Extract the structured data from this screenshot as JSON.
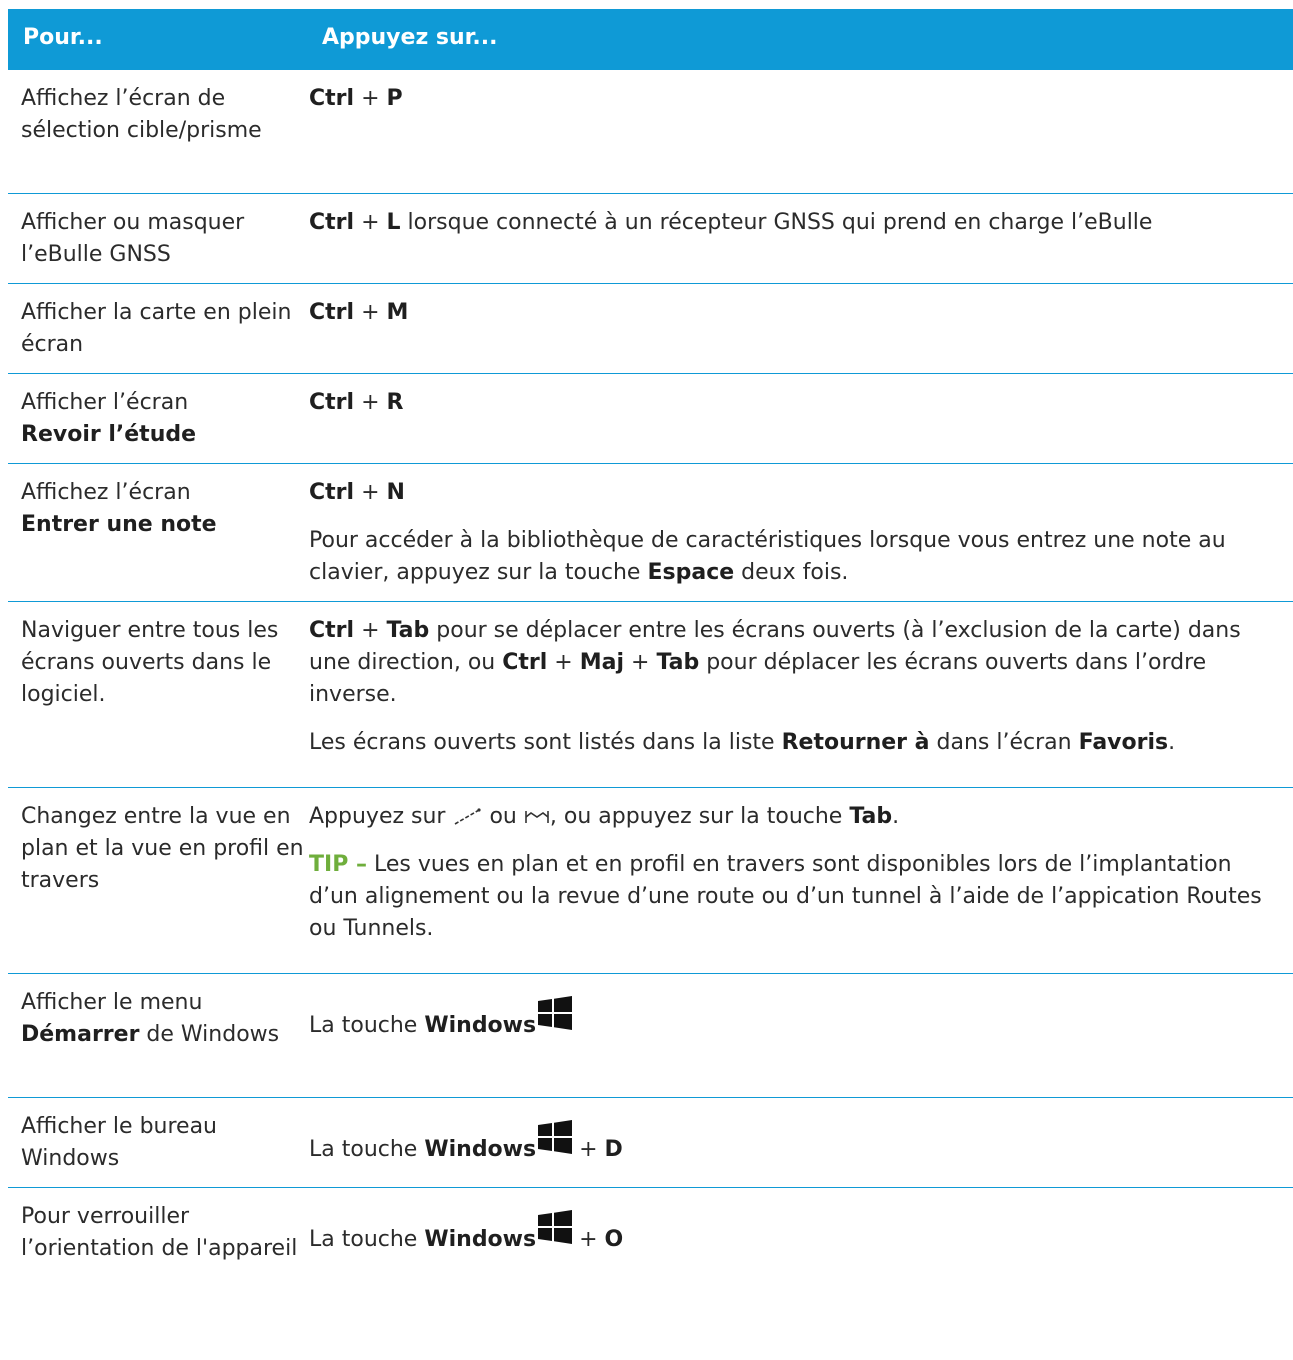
{
  "header": {
    "col1": "Pour...",
    "col2": "Appuyez sur..."
  },
  "rows": {
    "r0": {
      "left": "Affichez l’écran de sélection cible/prisme",
      "ctrl": "Ctrl",
      "plus": "+",
      "key": "P"
    },
    "r1": {
      "left": "Afficher ou masquer l’eBulle GNSS",
      "ctrl": "Ctrl",
      "plus": "+",
      "key": "L",
      "rest": "lorsque connecté à un récepteur GNSS qui prend en charge l’eBulle"
    },
    "r2": {
      "left": "Afficher la carte en plein écran",
      "ctrl": "Ctrl",
      "plus": "+",
      "key": "M"
    },
    "r3": {
      "left_a": "Afficher l’écran",
      "left_b": "Revoir l’étude",
      "ctrl": "Ctrl",
      "plus": "+",
      "key": "R"
    },
    "r4": {
      "left_a": "Affichez l’écran",
      "left_b": "Entrer une note",
      "ctrl": "Ctrl",
      "plus": "+",
      "key": "N",
      "p2_a": "Pour accéder à la bibliothèque de caractéristiques lorsque vous entrez une note au clavier, appuyez sur la touche",
      "p2_b": "Espace",
      "p2_c": "deux fois."
    },
    "r5": {
      "left": "Naviguer entre tous les écrans ouverts dans le logiciel.",
      "ctrl": "Ctrl",
      "plus": "+",
      "tab": "Tab",
      "t1": "pour se déplacer entre les écrans ouverts (à l’exclusion de la carte) dans une direction, ou",
      "maj": "Maj",
      "t2": "pour déplacer les écrans ouverts dans l’ordre inverse.",
      "p2_a": "Les écrans ouverts sont listés dans la liste",
      "p2_b": "Retourner à",
      "p2_c": "dans l’écran",
      "p2_d": "Favoris",
      "p2_e": "."
    },
    "r6": {
      "left": "Changez entre la vue en plan et la vue en profil en travers",
      "a": "Appuyez sur",
      "ou": "ou",
      "b": ", ou appuyez sur la touche",
      "tab": "Tab",
      "dot": ".",
      "tip_label": "TIP –",
      "tip_text": "Les vues en plan et en profil en travers sont disponibles lors de l’implantation d’un alignement ou la revue d’une route ou d’un tunnel à l’aide de l’appication Routes ou Tunnels."
    },
    "r7": {
      "left_a": "Afficher le menu",
      "left_b": "Démarrer",
      "left_c": "de Windows",
      "a": "La touche",
      "win": "Windows"
    },
    "r8": {
      "left": "Afficher le bureau Windows",
      "a": "La touche",
      "win": "Windows",
      "plus": "+",
      "key": "D"
    },
    "r9": {
      "left": "Pour verrouiller l’orientation de l'appareil",
      "a": "La touche",
      "win": "Windows",
      "plus": "+",
      "key": "O"
    }
  },
  "colors": {
    "header_bg": "#0f9ad6",
    "tip": "#6fae3c",
    "rule": "#0f9ad6"
  },
  "icons": [
    "line-view-icon",
    "profile-view-icon",
    "windows-logo-icon"
  ]
}
